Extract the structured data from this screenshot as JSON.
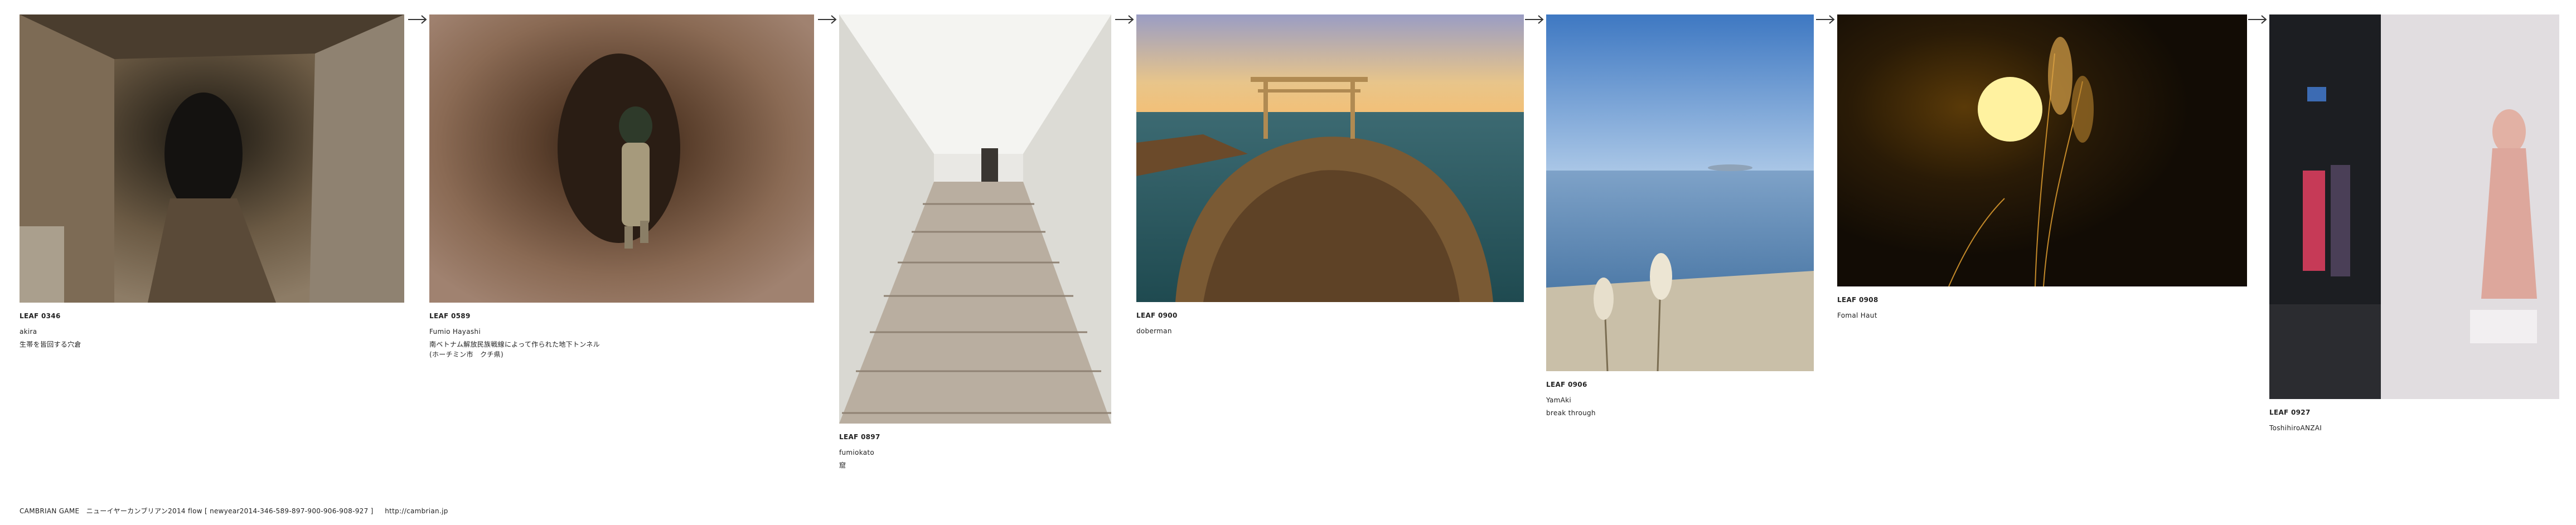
{
  "arrow_glyph": "arrow-right-icon",
  "leaves": [
    {
      "code": "LEAF 0346",
      "author": "akira",
      "title": [
        "生帯を皆回する穴倉"
      ]
    },
    {
      "code": "LEAF 0589",
      "author": "Fumio Hayashi",
      "title": [
        "南ベトナム解放民族戦線によって作られた地下トンネル",
        "(ホーチミン市　クチ県)"
      ]
    },
    {
      "code": "LEAF 0897",
      "author": "fumiokato",
      "title": [
        "窟"
      ]
    },
    {
      "code": "LEAF 0900",
      "author": "doberman",
      "title": []
    },
    {
      "code": "LEAF 0906",
      "author": "YamAki",
      "title": [
        " break through"
      ]
    },
    {
      "code": "LEAF 0908",
      "author": "Fomal Haut",
      "title": []
    },
    {
      "code": "LEAF 0927",
      "author": "ToshihiroANZAI",
      "title": []
    }
  ],
  "footer": {
    "text": "CAMBRIAN GAME　ニューイヤーカンブリアン2014  flow [ newyear2014-346-589-897-900-906-908-927 ]",
    "link": "http://cambrian.jp"
  }
}
